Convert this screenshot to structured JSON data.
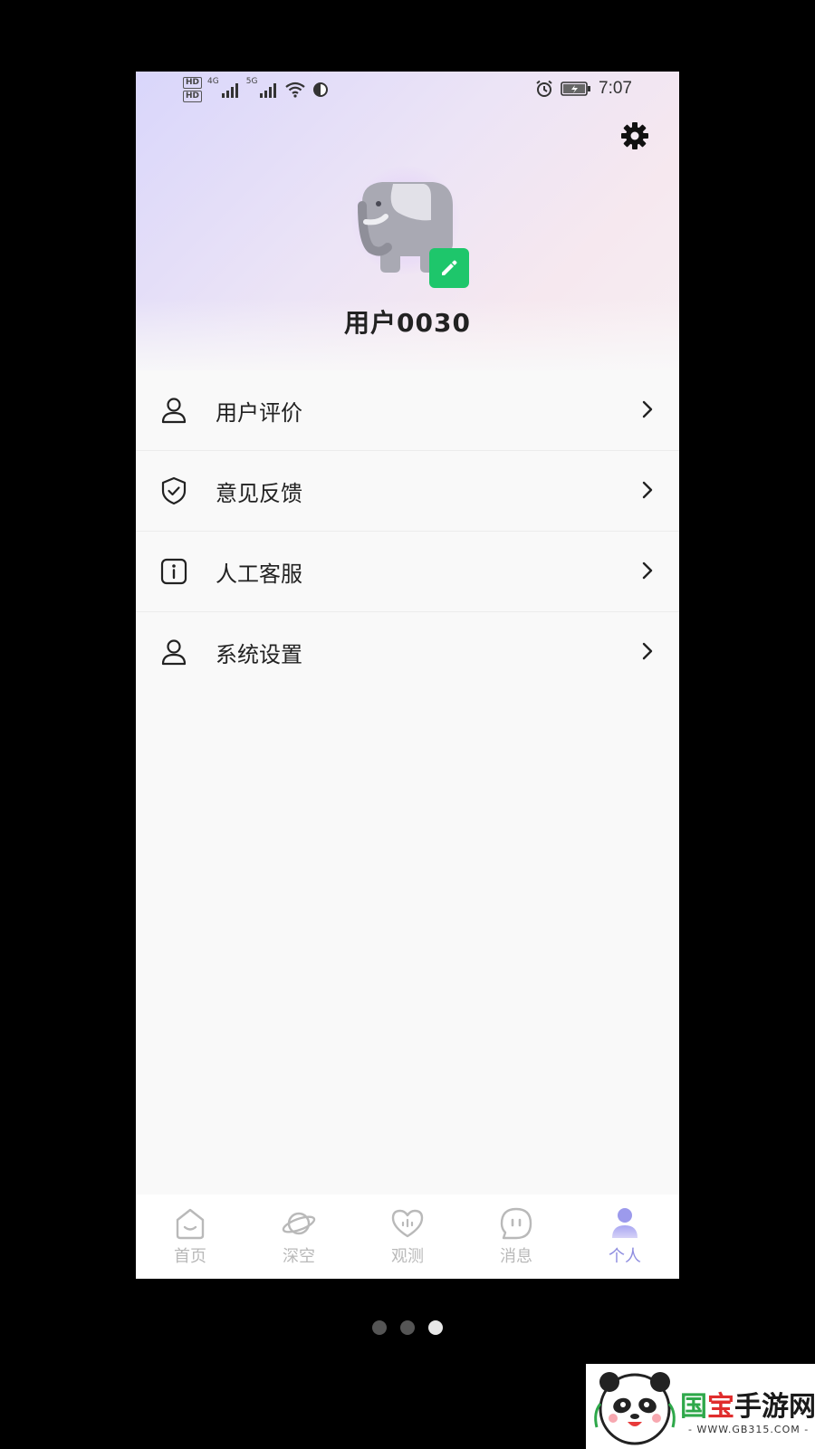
{
  "status_bar": {
    "hd1": "HD",
    "hd2": "HD",
    "net1": "4G",
    "net2": "5G",
    "time": "7:07"
  },
  "profile": {
    "username": "用户0030"
  },
  "menu": [
    {
      "label": "用户评价",
      "icon": "person-icon"
    },
    {
      "label": "意见反馈",
      "icon": "shield-check-icon"
    },
    {
      "label": "人工客服",
      "icon": "info-icon"
    },
    {
      "label": "系统设置",
      "icon": "person-icon"
    }
  ],
  "tabs": [
    {
      "label": "首页",
      "icon": "home-icon",
      "active": false
    },
    {
      "label": "深空",
      "icon": "planet-icon",
      "active": false
    },
    {
      "label": "观测",
      "icon": "heart-icon",
      "active": false
    },
    {
      "label": "消息",
      "icon": "message-icon",
      "active": false
    },
    {
      "label": "个人",
      "icon": "profile-icon",
      "active": true
    }
  ],
  "pager": {
    "count": 3,
    "active_index": 2
  },
  "watermark": {
    "text_part1": "国",
    "text_part2": "宝",
    "text_part3": "手游网",
    "url": "- WWW.GB315.COM -"
  },
  "colors": {
    "accent_green": "#1ec66b",
    "tab_active": "#8e8de0",
    "tab_inactive": "#b9b9b9"
  }
}
